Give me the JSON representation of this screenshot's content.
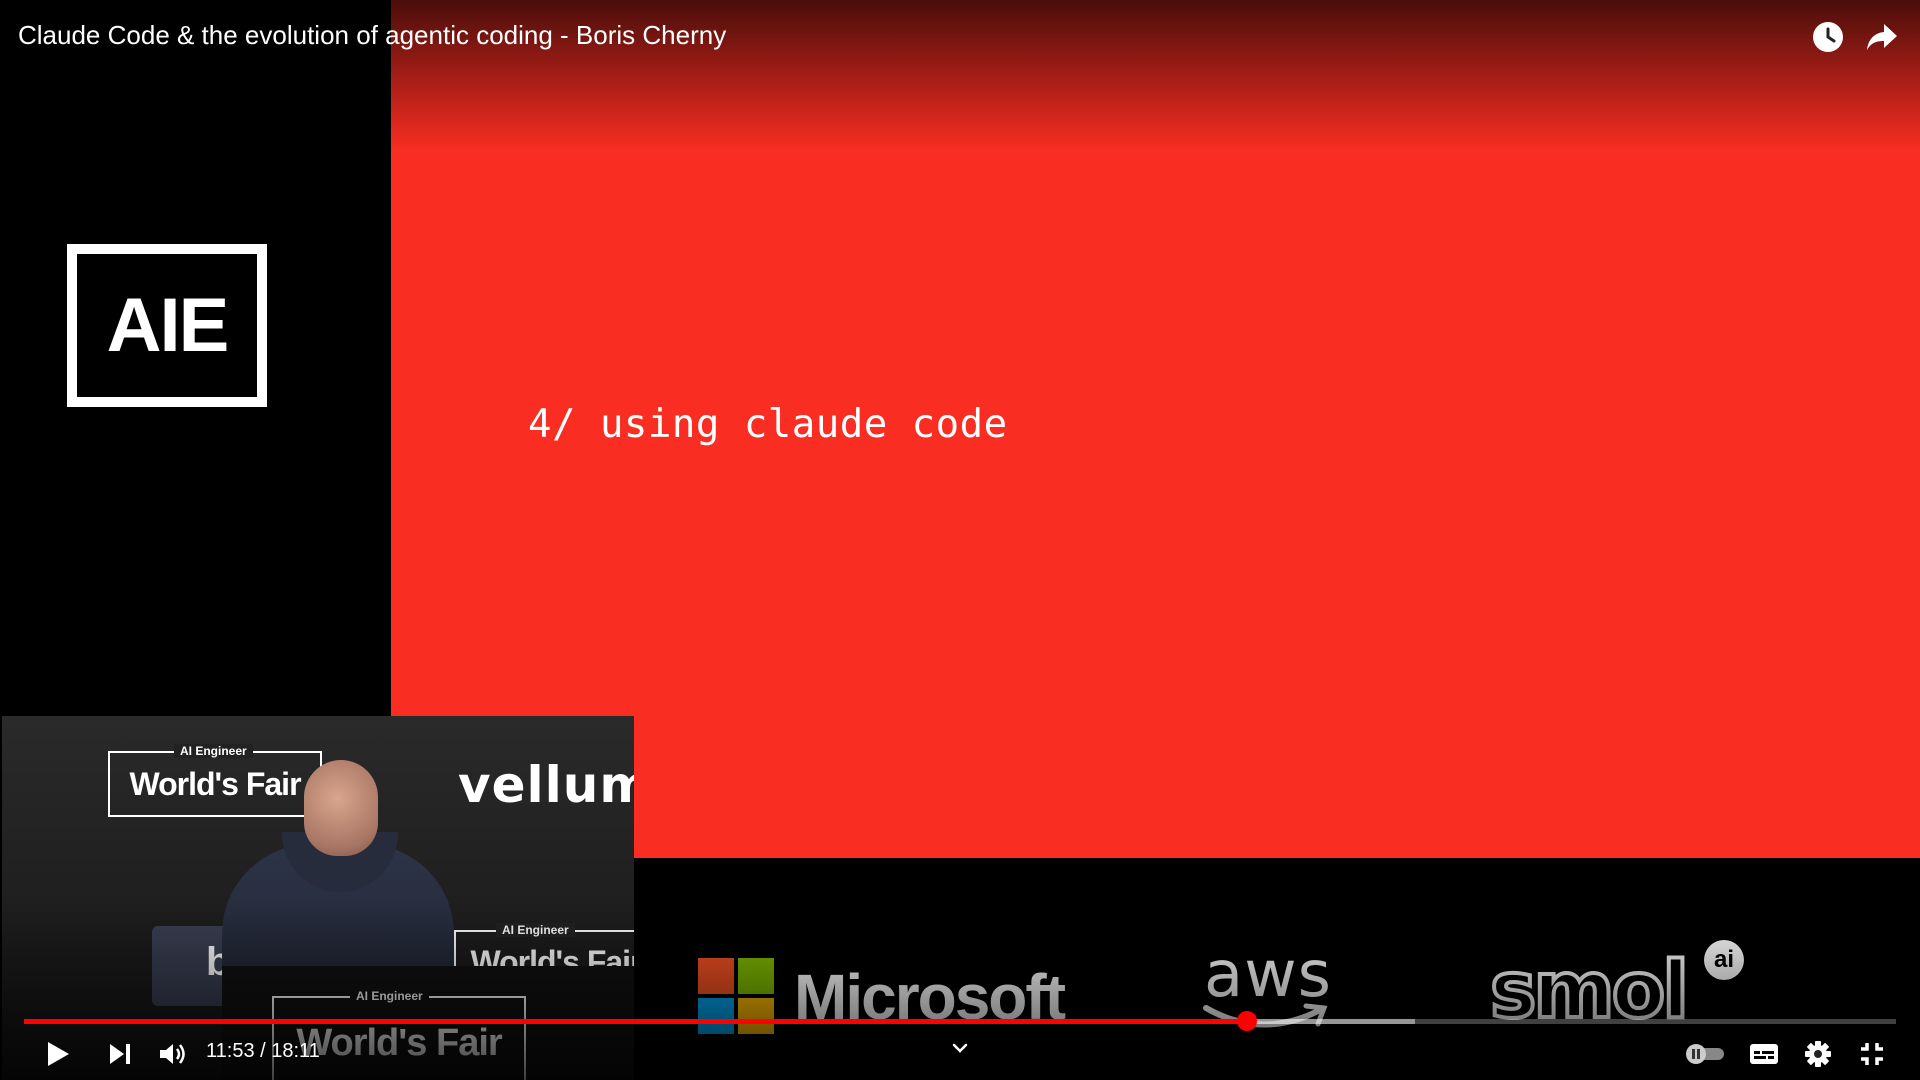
{
  "video": {
    "title": "Claude Code & the evolution of agentic coding - Boris Cherny",
    "current_time": "11:53",
    "duration": "18:11",
    "time_separator": " / ",
    "progress_fraction": 0.6532,
    "buffered_fraction": 0.743
  },
  "slide": {
    "text": "4/ using claude code",
    "background_color": "#f92d22"
  },
  "logo": {
    "text": "AIE"
  },
  "camera": {
    "event_small": "AI Engineer",
    "event_big": "World's Fair",
    "sponsor": "vellum",
    "partial_logo": "b"
  },
  "sponsors": {
    "microsoft": "Microsoft",
    "aws": "aws",
    "smol": "smol",
    "smol_badge": "ai"
  },
  "colors": {
    "progress": "#ff0000",
    "ms_red": "#f25022",
    "ms_green": "#7fba00",
    "ms_blue": "#00a4ef",
    "ms_yellow": "#ffb900"
  },
  "icons": {
    "watch_later": "clock-icon",
    "share": "share-arrow-icon",
    "play": "play-icon",
    "next": "next-icon",
    "volume": "volume-icon",
    "chevron": "chevron-down-icon",
    "autoplay": "autoplay-toggle-icon",
    "captions": "captions-icon",
    "settings": "gear-icon",
    "exit_fullscreen": "exit-fullscreen-icon"
  }
}
